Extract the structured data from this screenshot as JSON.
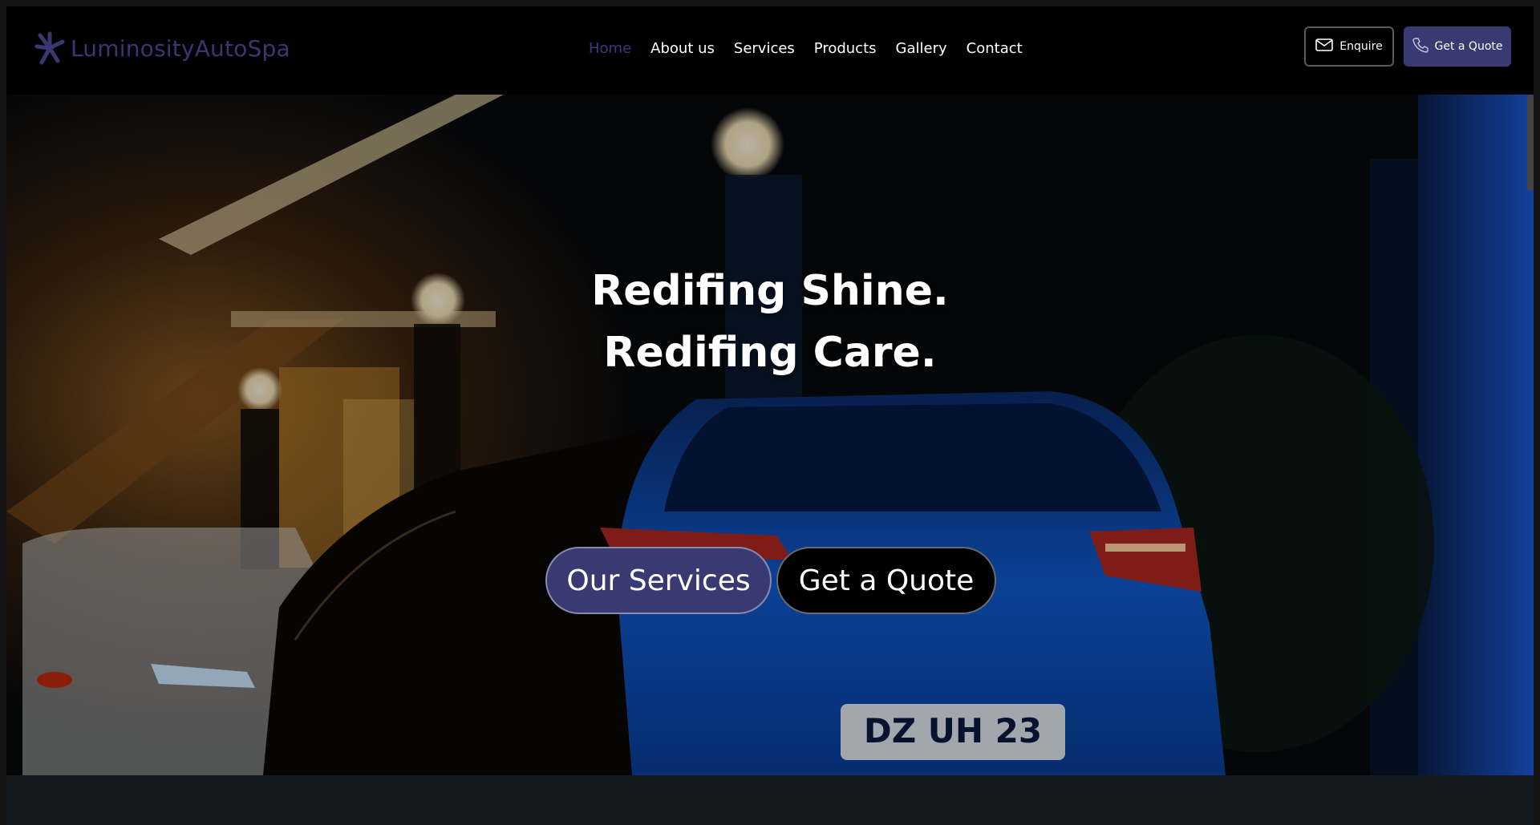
{
  "brand": {
    "name": "LuminosityAutoSpa",
    "logo_icon": "starburst-icon"
  },
  "nav": {
    "items": [
      {
        "label": "Home",
        "active": true
      },
      {
        "label": "About us"
      },
      {
        "label": "Services"
      },
      {
        "label": "Products"
      },
      {
        "label": "Gallery"
      },
      {
        "label": "Contact"
      }
    ]
  },
  "header_buttons": {
    "enquire": {
      "label": "Enquire",
      "icon": "mail-icon"
    },
    "quote": {
      "label": "Get a Quote",
      "icon": "phone-icon"
    }
  },
  "hero": {
    "line1": "Redifing Shine.",
    "line2": "Redifing Care.",
    "primary_button": "Our Services",
    "secondary_button": "Get a Quote",
    "background": "night-street-cars-photo"
  },
  "colors": {
    "accent": "#3a3a72",
    "active_nav": "#3b3880",
    "logo": "#3a3770"
  }
}
